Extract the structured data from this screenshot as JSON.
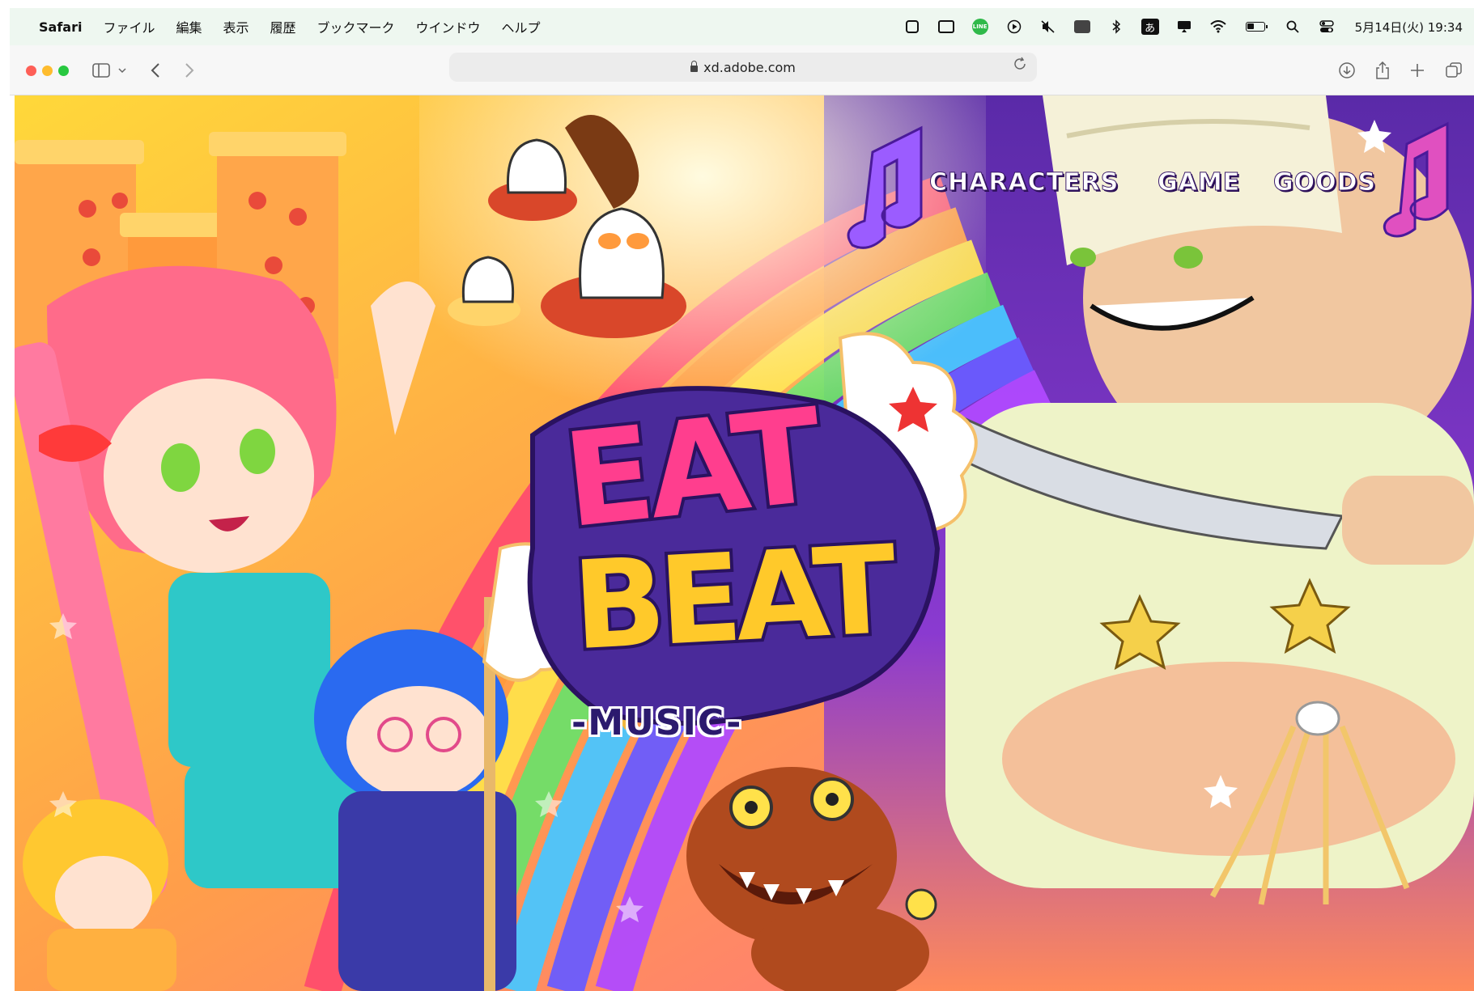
{
  "menubar": {
    "app_name": "Safari",
    "menus": [
      "ファイル",
      "編集",
      "表示",
      "履歴",
      "ブックマーク",
      "ウインドウ",
      "ヘルプ"
    ],
    "ime_label": "あ",
    "line_label": "LINE",
    "clock": "5月14日(火) 19:34"
  },
  "toolbar": {
    "url": "xd.adobe.com"
  },
  "hero": {
    "nav": [
      "CHARACTERS",
      "GAME",
      "GOODS"
    ],
    "logo_line1": "EAT",
    "logo_line2": "BEAT",
    "logo_sub": "-MUSIC-"
  }
}
